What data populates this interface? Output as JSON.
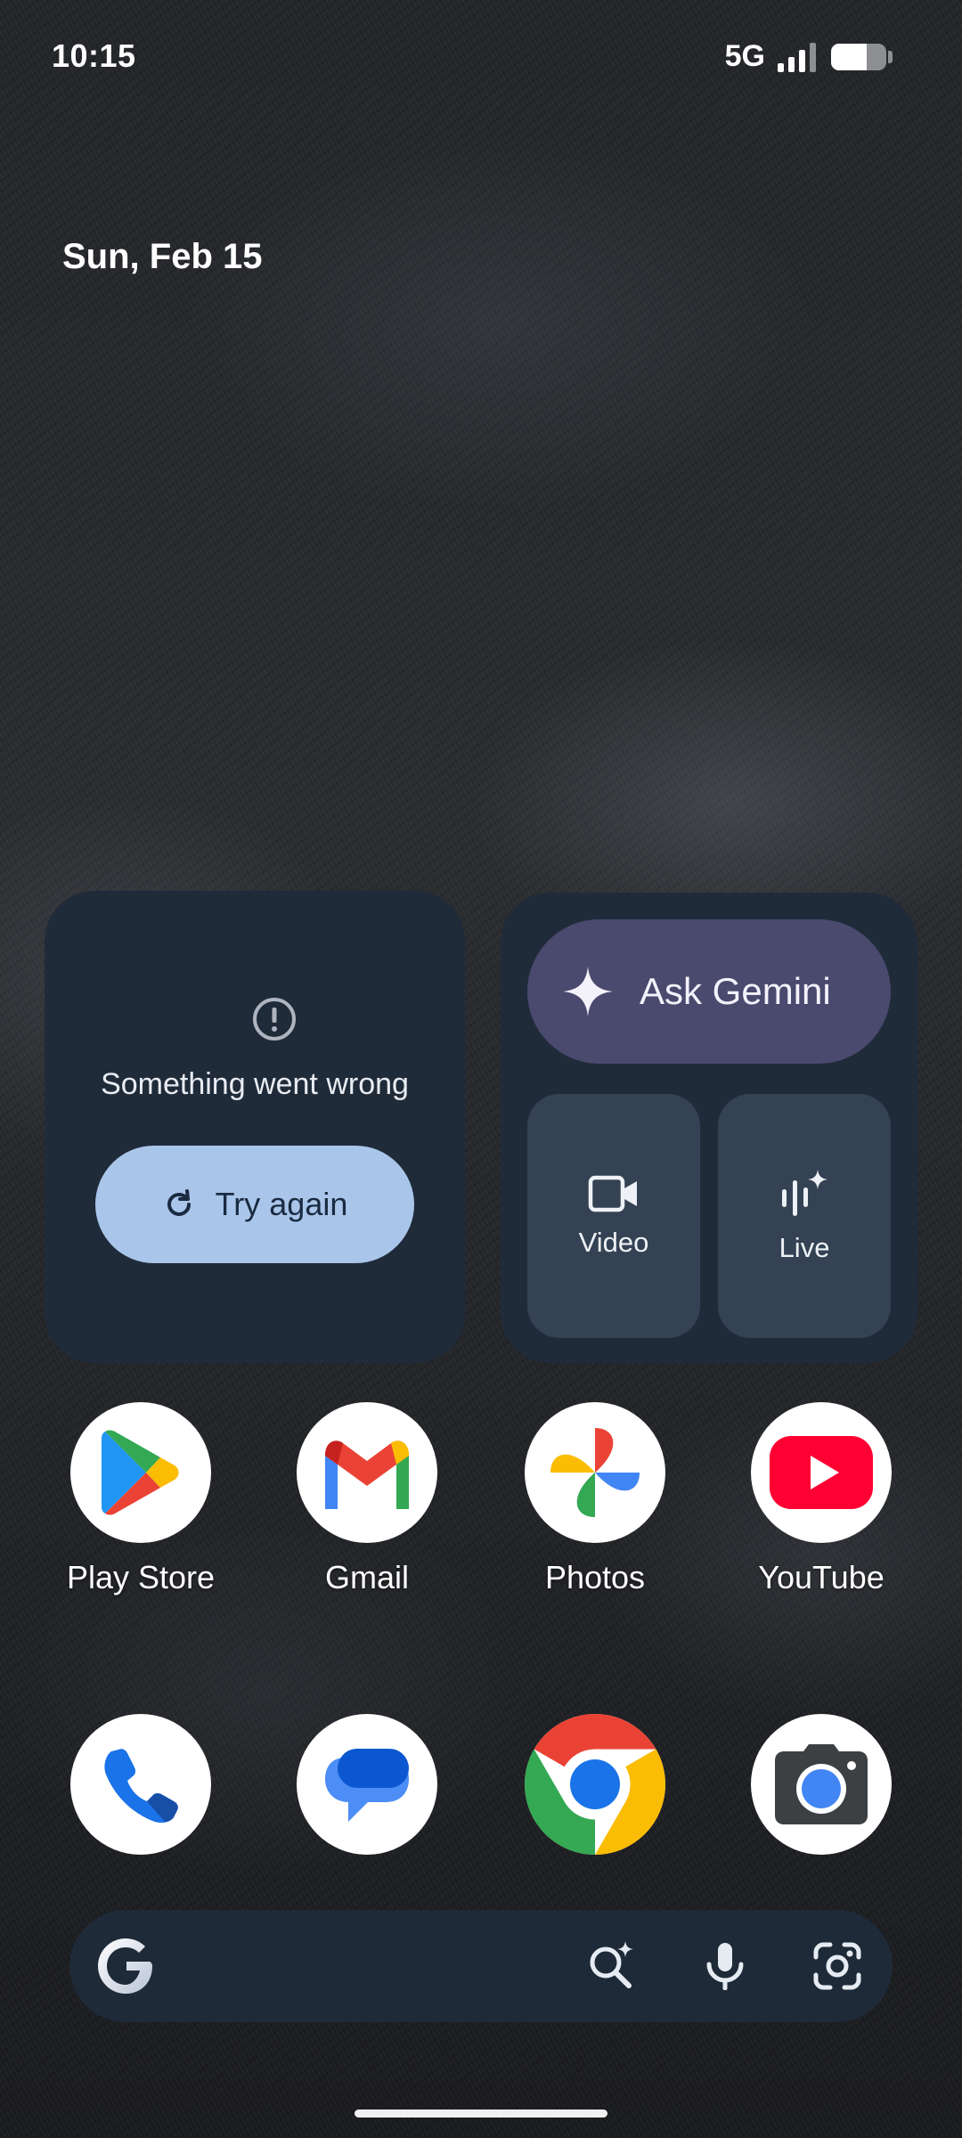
{
  "status_bar": {
    "time": "10:15",
    "network": "5G",
    "signal_bars": 3,
    "signal_bars_max": 4,
    "battery_level": 0.65
  },
  "date": "Sun, Feb 15",
  "error_widget": {
    "icon": "alert-circle-icon",
    "message": "Something went wrong",
    "retry_label": "Try again",
    "retry_icon": "refresh-icon",
    "button_color": "#a9c6ea"
  },
  "gemini_widget": {
    "ask_label": "Ask Gemini",
    "ask_icon": "sparkle-icon",
    "ask_color": "#4a4a6e",
    "tiles": [
      {
        "label": "Video",
        "icon": "video-camera-icon"
      },
      {
        "label": "Live",
        "icon": "live-waveform-icon"
      }
    ]
  },
  "apps_row1": [
    {
      "label": "Play Store",
      "icon": "play-store-icon"
    },
    {
      "label": "Gmail",
      "icon": "gmail-icon"
    },
    {
      "label": "Photos",
      "icon": "photos-icon"
    },
    {
      "label": "YouTube",
      "icon": "youtube-icon"
    }
  ],
  "dock": [
    {
      "name": "Phone",
      "icon": "phone-icon"
    },
    {
      "name": "Messages",
      "icon": "messages-icon"
    },
    {
      "name": "Chrome",
      "icon": "chrome-icon"
    },
    {
      "name": "Camera",
      "icon": "camera-icon"
    }
  ],
  "search_bar": {
    "logo": "google-g-icon",
    "icons": [
      "ai-search-icon",
      "microphone-icon",
      "lens-icon"
    ]
  }
}
